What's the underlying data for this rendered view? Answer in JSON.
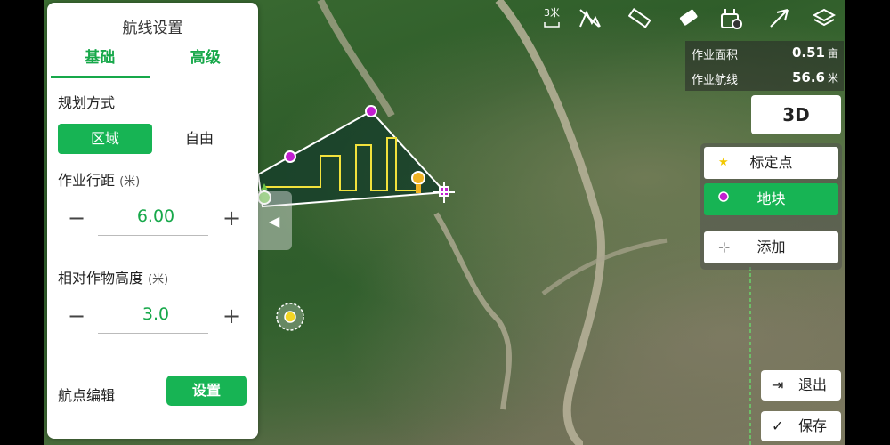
{
  "panel": {
    "title": "航线设置",
    "tabs": [
      "基础",
      "高级"
    ],
    "planning_label": "规划方式",
    "planning_options": [
      "区域",
      "自由"
    ],
    "spacing_label": "作业行距",
    "spacing_unit": "(米)",
    "spacing_value": "6.00",
    "height_label": "相对作物高度",
    "height_unit": "(米)",
    "height_value": "3.0",
    "waypoint_label": "航点编辑",
    "set_button": "设置",
    "minus": "−",
    "plus": "+"
  },
  "toolbar": {
    "scale_label": "3米",
    "icons": [
      "scale-icon",
      "no-terrain-icon",
      "ruler-icon",
      "eraser-icon",
      "remote-controller-icon",
      "navigate-arrow-icon",
      "layers-icon"
    ]
  },
  "stats": {
    "area_label": "作业面积",
    "area_value": "0.51",
    "area_unit": "亩",
    "route_label": "作业航线",
    "route_value": "56.6",
    "route_unit": "米"
  },
  "view_button": "3D",
  "markers": {
    "calibration_point": "标定点",
    "plot": "地块",
    "add": "添加"
  },
  "actions": {
    "exit": "退出",
    "save": "保存"
  },
  "colors": {
    "accent_green": "#17b454",
    "route_yellow": "#f2e23c",
    "waypoint_purple": "#c21fd0"
  }
}
